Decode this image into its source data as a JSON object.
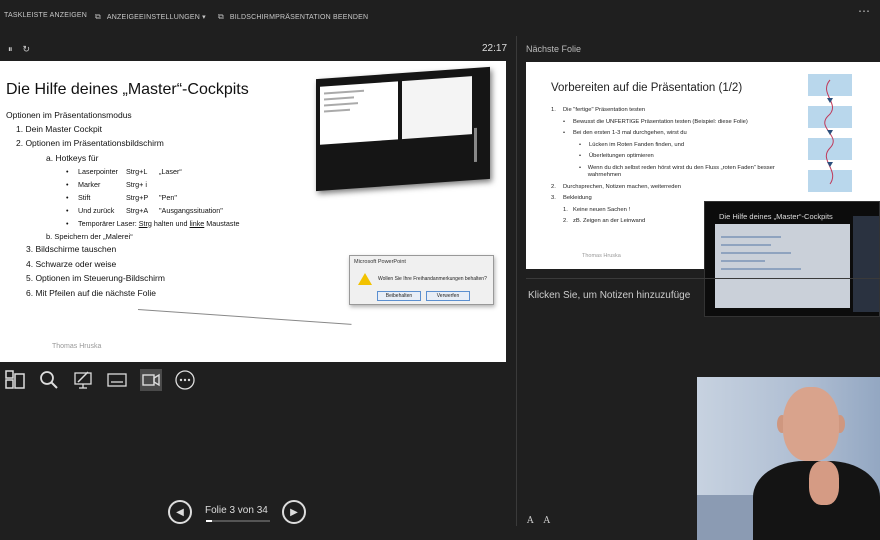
{
  "toolbar": {
    "show_taskbar": "TASKLEISTE ANZEIGEN",
    "display_settings": "ANZEIGEEINSTELLUNGEN ▾",
    "end_show": "BILDSCHIRMPRÄSENTATION BEENDEN",
    "more_icon": "more-icon"
  },
  "presenter": {
    "timer": "22:17",
    "current_slide": {
      "title": "Die Hilfe deines „Master“-Cockpits",
      "body": {
        "intro": "Optionen im Präsentationsmodus",
        "item1": "1. Dein Master Cockpit",
        "item2": "2. Optionen im Präsentationsbildschirm",
        "sub_a": "a. Hotkeys für",
        "hotkeys": [
          {
            "name": "Laserpointer",
            "key": "Strg+L",
            "desc": "„Laser“"
          },
          {
            "name": "Marker",
            "key": "Strg+ i",
            "desc": ""
          },
          {
            "name": "Stift",
            "key": "Strg+P",
            "desc": "\"Pen\""
          },
          {
            "name": "Und zurück",
            "key": "Strg+A",
            "desc": "\"Ausgangssituation\""
          }
        ],
        "temp_laser": "Temporärer Laser:",
        "temp_laser_strg": "Strg",
        "temp_laser_mid": " halten und ",
        "temp_laser_linke": "linke",
        "temp_laser_end": " Maustaste",
        "sub_b": "b. Speichern der „Malerei“",
        "item3": "3. Bildschirme tauschen",
        "item4": "4. Schwarze oder weise",
        "item5": "5. Optionen im Steuerung-Bildschirm",
        "item6": "6. Mit Pfeilen auf die nächste Folie"
      },
      "footer": "Thomas Hruska",
      "dialog": {
        "title": "Microsoft PowerPoint",
        "message": "Wollen Sie Ihre Freihandanmerkungen behalten?",
        "keep": "Beibehalten",
        "discard": "Verwerfen"
      }
    },
    "nav": {
      "label": "Folie 3 von 34",
      "progress": 0.088
    }
  },
  "next": {
    "label": "Nächste Folie",
    "slide": {
      "title": "Vorbereiten auf die Präsentation (1/2)",
      "rows": [
        {
          "num": "1.",
          "text": "Die \"fertige\" Präsentation testen"
        },
        {
          "num": "•",
          "text": "Bewusst die UNFERTIGE Präsentation testen (Beispiel: diese Folie)"
        },
        {
          "num": "•",
          "text": "Bei den ersten 1-3 mal durchgehen, wirst du"
        },
        {
          "num": "•",
          "text": "Lücken im Roten Fanden finden, und"
        },
        {
          "num": "•",
          "text": "Überleitungen optimieren"
        },
        {
          "num": "•",
          "text": "Wenn du dich selbst reden hörst wirst du den Fluss „roten Faden“ besser wahrnehmen"
        },
        {
          "num": "2.",
          "text": "Durchsprechen, Notizen machen, weiterreden"
        },
        {
          "num": "3.",
          "text": "Bekleidung"
        },
        {
          "num": "1.",
          "text": "Keine neuen Sachen !"
        },
        {
          "num": "2.",
          "text": "zB. Zeigen an der Leinwand"
        }
      ],
      "footer": "Thomas Hruska"
    },
    "pip_title": "Die Hilfe deines „Master“-Cockpits"
  },
  "notes": {
    "placeholder": "Klicken Sie, um Notizen hinzuzufüge"
  },
  "font_controls": {
    "bigger": "A",
    "smaller": "A"
  },
  "tools": [
    "slides-overview-icon",
    "zoom-icon",
    "pen-icon",
    "subtitles-icon",
    "camera-icon",
    "more-options-icon"
  ]
}
